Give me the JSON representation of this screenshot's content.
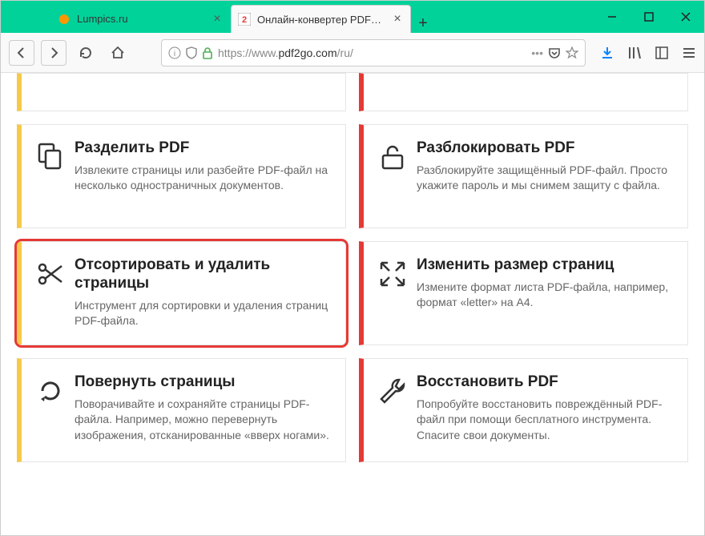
{
  "tabs": [
    {
      "title": "Lumpics.ru"
    },
    {
      "title": "Онлайн-конвертер PDF-файл"
    }
  ],
  "url": {
    "prefix": "https://www.",
    "domain": "pdf2go.com",
    "path": "/ru/"
  },
  "cards": [
    {
      "side": "yellow",
      "title": "Разделить PDF",
      "desc": "Извлеките страницы или разбейте PDF-файл на несколько одностраничных документов."
    },
    {
      "side": "red",
      "title": "Разблокировать PDF",
      "desc": "Разблокируйте защищённый PDF-файл. Просто укажите пароль и мы снимем защиту с файла."
    },
    {
      "side": "yellow",
      "title": "Отсортировать и удалить страницы",
      "desc": "Инструмент для сортировки и удаления страниц PDF-файла."
    },
    {
      "side": "red",
      "title": "Изменить размер страниц",
      "desc": "Измените формат листа PDF-файла, например, формат «letter» на A4."
    },
    {
      "side": "yellow",
      "title": "Повернуть страницы",
      "desc": "Поворачивайте и сохраняйте страницы PDF-файла. Например, можно перевернуть изображения, отсканированные «вверх ногами»."
    },
    {
      "side": "red",
      "title": "Восстановить PDF",
      "desc": "Попробуйте восстановить повреждённый PDF-файл при помощи бесплатного инструмента. Спасите свои документы."
    }
  ]
}
